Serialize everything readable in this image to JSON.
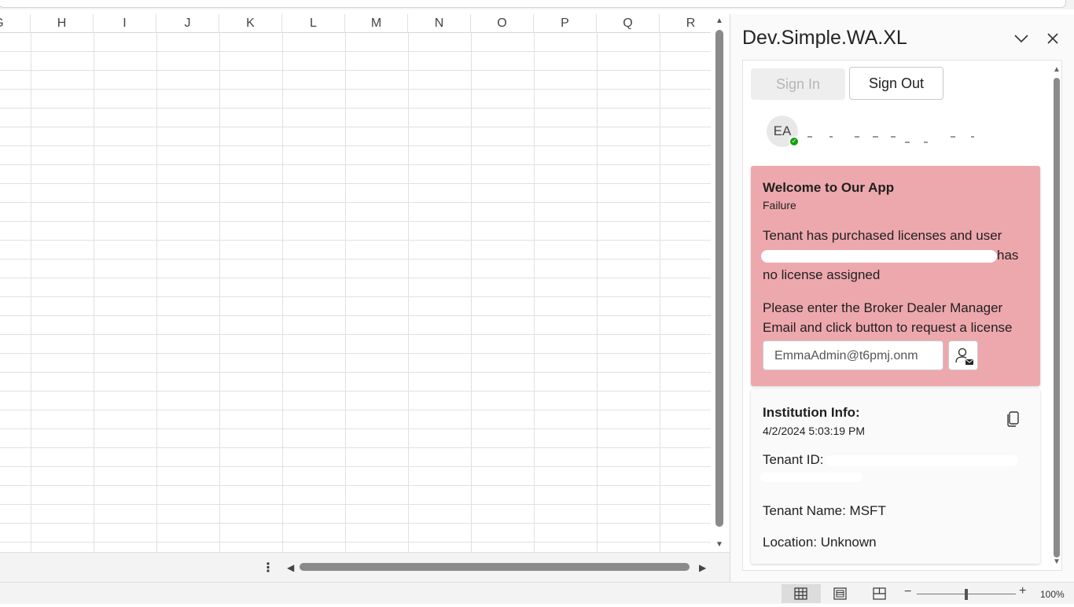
{
  "grid": {
    "columns": [
      "G",
      "H",
      "I",
      "J",
      "K",
      "L",
      "M",
      "N",
      "O",
      "P",
      "Q",
      "R"
    ]
  },
  "pane": {
    "title": "Dev.Simple.WA.XL",
    "sign_in_label": "Sign In",
    "sign_out_label": "Sign Out",
    "user": {
      "initials": "EA",
      "status": "online"
    },
    "failure_card": {
      "title": "Welcome to Our App",
      "subtitle": "Failure",
      "message_start": "Tenant has purchased licenses and user",
      "message_end": "has no license assigned",
      "prompt": "Please enter the Broker Dealer Manager Email and click button to request a license",
      "email_value": "EmmaAdmin@t6pmj.onm",
      "background_color": "#eda8ae"
    },
    "info_card": {
      "title": "Institution Info:",
      "date": "4/2/2024 5:03:19 PM",
      "tenant_id_label": "Tenant ID:",
      "tenant_name": "Tenant Name: MSFT",
      "location": "Location: Unknown"
    }
  },
  "status_bar": {
    "zoom_level": "100%",
    "zoom_percent": 100
  }
}
